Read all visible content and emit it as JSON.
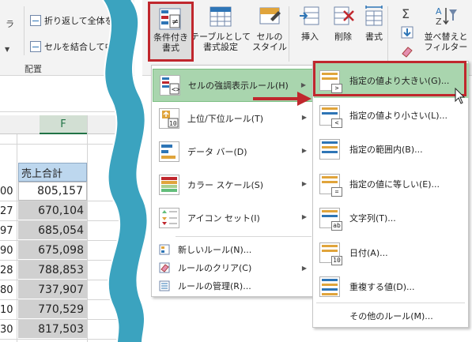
{
  "ribbon_left": {
    "wrap_text": "折り返して全体を",
    "merge_center": "セルを結合して中",
    "group_label": "配置"
  },
  "sheet_left": {
    "column_header": "F",
    "sales_header": "売上合計",
    "rows": [
      {
        "left": "00",
        "value": "805,157"
      },
      {
        "left": "27",
        "value": "670,104"
      },
      {
        "left": "97",
        "value": "685,054"
      },
      {
        "left": "90",
        "value": "675,098"
      },
      {
        "left": "28",
        "value": "788,853"
      },
      {
        "left": "80",
        "value": "737,907"
      },
      {
        "left": "10",
        "value": "770,529"
      },
      {
        "left": "30",
        "value": "817,503"
      }
    ]
  },
  "ribbon_right": {
    "conditional_formatting": "条件付き\n書式",
    "format_as_table": "テーブルとして\n書式設定",
    "cell_styles": "セルの\nスタイル",
    "insert": "挿入",
    "delete": "削除",
    "format": "書式",
    "sort_filter": "並べ替えと\nフィルター"
  },
  "menu1": {
    "items": [
      {
        "label": "セルの強調表示ルール(H)",
        "icon": "highlight-rules-icon"
      },
      {
        "label": "上位/下位ルール(T)",
        "icon": "top-bottom-icon"
      },
      {
        "label": "データ バー(D)",
        "icon": "data-bars-icon"
      },
      {
        "label": "カラー スケール(S)",
        "icon": "color-scales-icon"
      },
      {
        "label": "アイコン セット(I)",
        "icon": "icon-sets-icon"
      }
    ],
    "small_items": [
      {
        "label": "新しいルール(N)...",
        "icon": "new-rule-icon"
      },
      {
        "label": "ルールのクリア(C)",
        "icon": "clear-rules-icon"
      },
      {
        "label": "ルールの管理(R)...",
        "icon": "manage-rules-icon"
      }
    ]
  },
  "menu2": {
    "items": [
      {
        "label": "指定の値より大きい(G)...",
        "badge": ">"
      },
      {
        "label": "指定の値より小さい(L)...",
        "badge": "<"
      },
      {
        "label": "指定の範囲内(B)...",
        "badge": ""
      },
      {
        "label": "指定の値に等しい(E)...",
        "badge": "="
      },
      {
        "label": "文字列(T)...",
        "badge": "ab"
      },
      {
        "label": "日付(A)...",
        "badge": "10"
      },
      {
        "label": "重複する値(D)...",
        "badge": ""
      }
    ],
    "more_rules": "その他のルール(M)..."
  },
  "colors": {
    "highlight_green": "#a9d5ae",
    "red_frame": "#c0272d",
    "wave_blue": "#3ba3bf",
    "header_blue": "#bdd7ee"
  }
}
